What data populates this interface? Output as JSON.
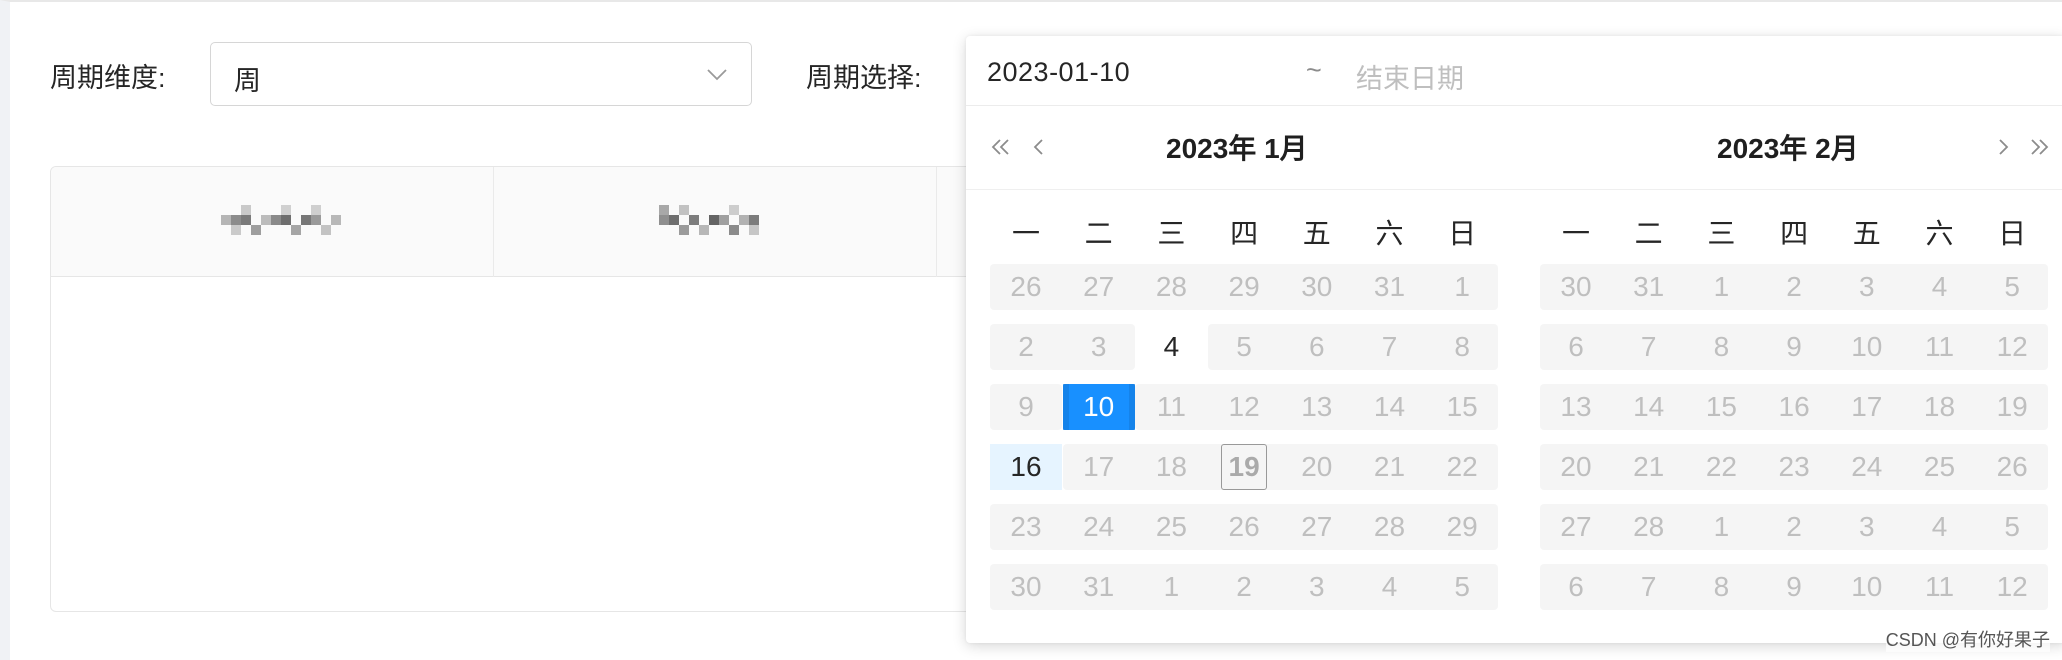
{
  "filters": {
    "period_dimension_label": "周期维度:",
    "period_dimension_value": "周",
    "period_select_label": "周期选择:"
  },
  "range_input": {
    "start_value": "2023-01-10",
    "separator": "~",
    "end_placeholder": "结束日期"
  },
  "calendar": {
    "weekdays": [
      "一",
      "二",
      "三",
      "四",
      "五",
      "六",
      "日"
    ],
    "left_title": "2023年 1月",
    "right_title": "2023年 2月",
    "left_weeks": [
      [
        "26",
        "27",
        "28",
        "29",
        "30",
        "31",
        "1"
      ],
      [
        "2",
        "3",
        "4",
        "5",
        "6",
        "7",
        "8"
      ],
      [
        "9",
        "10",
        "11",
        "12",
        "13",
        "14",
        "15"
      ],
      [
        "16",
        "17",
        "18",
        "19",
        "20",
        "21",
        "22"
      ],
      [
        "23",
        "24",
        "25",
        "26",
        "27",
        "28",
        "29"
      ],
      [
        "30",
        "31",
        "1",
        "2",
        "3",
        "4",
        "5"
      ]
    ],
    "right_weeks": [
      [
        "30",
        "31",
        "1",
        "2",
        "3",
        "4",
        "5"
      ],
      [
        "6",
        "7",
        "8",
        "9",
        "10",
        "11",
        "12"
      ],
      [
        "13",
        "14",
        "15",
        "16",
        "17",
        "18",
        "19"
      ],
      [
        "20",
        "21",
        "22",
        "23",
        "24",
        "25",
        "26"
      ],
      [
        "27",
        "28",
        "1",
        "2",
        "3",
        "4",
        "5"
      ],
      [
        "6",
        "7",
        "8",
        "9",
        "10",
        "11",
        "12"
      ]
    ],
    "selected_day": "10",
    "today_day": "19",
    "hover_day": "16"
  },
  "watermark": "CSDN @有你好果子",
  "colors": {
    "primary": "#1890ff",
    "hover_range": "#e6f4ff",
    "disabled_bg": "#f5f5f5",
    "disabled_text": "#bfbfbf"
  }
}
